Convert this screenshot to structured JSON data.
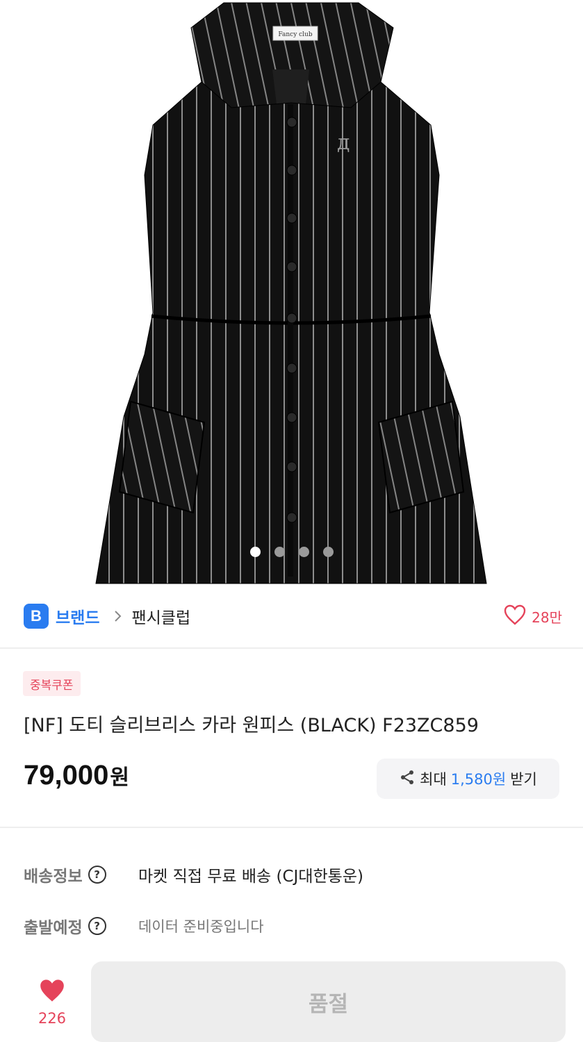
{
  "product_image": {
    "alt_icon": "dress-image",
    "carousel": {
      "count": 4,
      "active_index": 0
    },
    "label_tag": "Fancy club"
  },
  "brand": {
    "badge_letter": "B",
    "label": "브랜드",
    "name": "팬시클럽",
    "like_count": "28만"
  },
  "coupon_badge": "중복쿠폰",
  "product": {
    "title": "[NF] 도티 슬리브리스 카라 원피스 (BLACK) F23ZC859",
    "price": "79,000",
    "price_unit": "원"
  },
  "reward": {
    "prefix": "최대",
    "amount": "1,580원",
    "suffix": "받기"
  },
  "delivery": [
    {
      "label": "배송정보",
      "help": "?",
      "value": "마켓 직접 무료 배송 (CJ대한통운)"
    },
    {
      "label": "출발예정",
      "help": "?",
      "value": "데이터 준비중입니다"
    }
  ],
  "bottom_bar": {
    "like_count": "226",
    "buy_button": "품절"
  },
  "colors": {
    "accent_blue": "#2a7cf0",
    "accent_red": "#e5435a",
    "disabled_bg": "#ededed"
  }
}
